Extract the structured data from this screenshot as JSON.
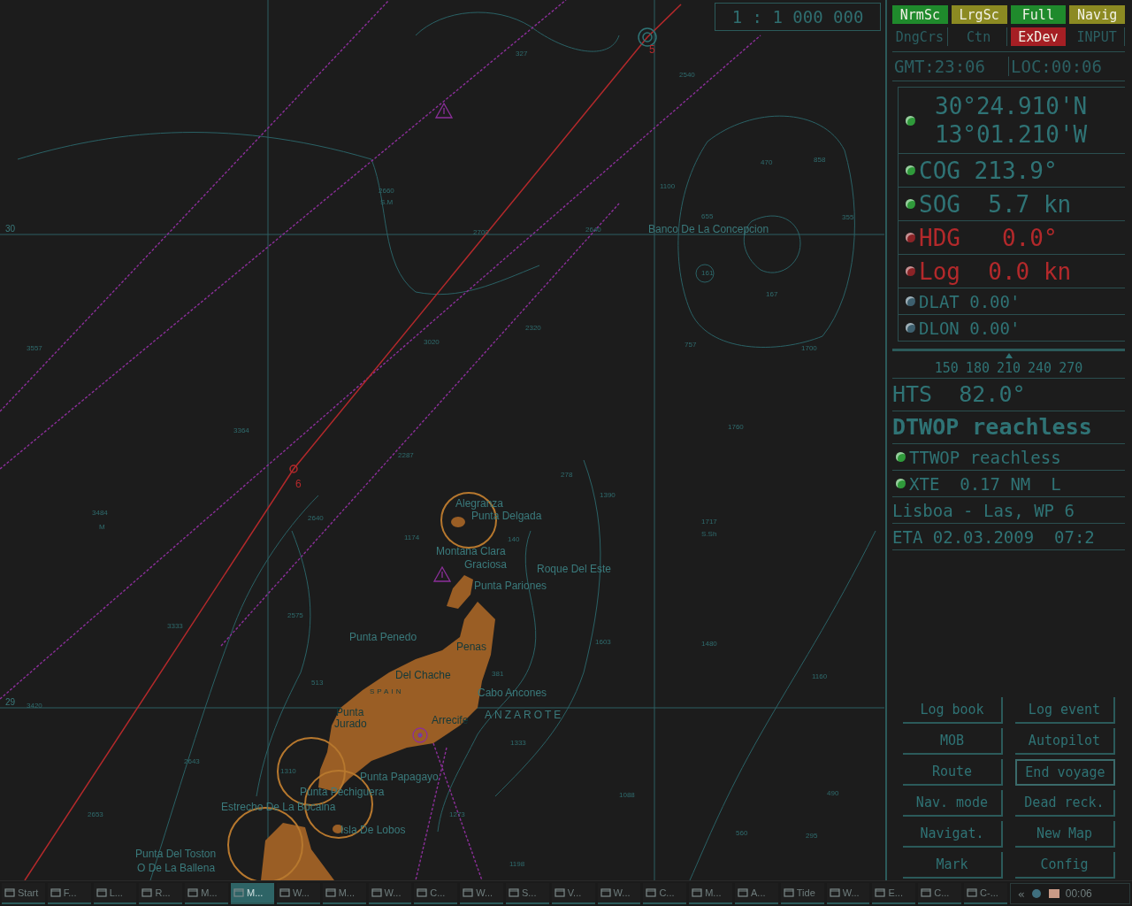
{
  "chart": {
    "scale": "1 : 1 000 000",
    "labels": [
      {
        "kind": "place",
        "text": "Banco De La Concepcion"
      },
      {
        "kind": "place",
        "text": "Alegranza"
      },
      {
        "kind": "place",
        "text": "Punta Delgada"
      },
      {
        "kind": "place",
        "text": "Montana Clara"
      },
      {
        "kind": "place",
        "text": "Graciosa"
      },
      {
        "kind": "place",
        "text": "Roque Del Este"
      },
      {
        "kind": "place",
        "text": "Punta Pariones"
      },
      {
        "kind": "place",
        "text": "Punta Penedo"
      },
      {
        "kind": "land",
        "text": "Penas"
      },
      {
        "kind": "land",
        "text": "Del Chache"
      },
      {
        "kind": "country",
        "text": "SPAIN"
      },
      {
        "kind": "place",
        "text": "Cabo Ancones"
      },
      {
        "kind": "land",
        "text": "Punta"
      },
      {
        "kind": "land",
        "text": "Jurado"
      },
      {
        "kind": "land",
        "text": "Arrecife"
      },
      {
        "kind": "island",
        "text": "ANZAROTE"
      },
      {
        "kind": "place",
        "text": "Punta Papagayo"
      },
      {
        "kind": "place",
        "text": "Punta Pechiguera"
      },
      {
        "kind": "place",
        "text": "Estrecho De La Bocaina"
      },
      {
        "kind": "place",
        "text": "Isla De Lobos"
      },
      {
        "kind": "place",
        "text": "Punta Del Toston"
      },
      {
        "kind": "place",
        "text": "O De La Ballena"
      },
      {
        "kind": "grid",
        "text": "30"
      },
      {
        "kind": "grid",
        "text": "29"
      },
      {
        "kind": "waypoint",
        "text": "5"
      },
      {
        "kind": "waypoint",
        "text": "6"
      },
      {
        "kind": "depth",
        "text": "327"
      },
      {
        "kind": "depth",
        "text": "2540"
      },
      {
        "kind": "depth",
        "text": "470"
      },
      {
        "kind": "depth",
        "text": "858"
      },
      {
        "kind": "depth",
        "text": "1100"
      },
      {
        "kind": "depth",
        "text": "2660"
      },
      {
        "kind": "depth",
        "text": "S.M"
      },
      {
        "kind": "depth",
        "text": "655"
      },
      {
        "kind": "depth",
        "text": "355"
      },
      {
        "kind": "depth",
        "text": "2640"
      },
      {
        "kind": "depth",
        "text": "2700"
      },
      {
        "kind": "depth",
        "text": "161"
      },
      {
        "kind": "depth",
        "text": "167"
      },
      {
        "kind": "depth",
        "text": "2320"
      },
      {
        "kind": "depth",
        "text": "3020"
      },
      {
        "kind": "depth",
        "text": "757"
      },
      {
        "kind": "depth",
        "text": "1700"
      },
      {
        "kind": "depth",
        "text": "3557"
      },
      {
        "kind": "depth",
        "text": "3364"
      },
      {
        "kind": "depth",
        "text": "2287"
      },
      {
        "kind": "depth",
        "text": "1760"
      },
      {
        "kind": "depth",
        "text": "278"
      },
      {
        "kind": "depth",
        "text": "1390"
      },
      {
        "kind": "depth",
        "text": "3484"
      },
      {
        "kind": "depth",
        "text": "2640"
      },
      {
        "kind": "depth",
        "text": "1174"
      },
      {
        "kind": "depth",
        "text": "140"
      },
      {
        "kind": "depth",
        "text": "1717"
      },
      {
        "kind": "depth",
        "text": "S.Sh"
      },
      {
        "kind": "depth",
        "text": "2575"
      },
      {
        "kind": "depth",
        "text": "3333"
      },
      {
        "kind": "depth",
        "text": "1603"
      },
      {
        "kind": "depth",
        "text": "1480"
      },
      {
        "kind": "depth",
        "text": "513"
      },
      {
        "kind": "depth",
        "text": "381"
      },
      {
        "kind": "depth",
        "text": "1160"
      },
      {
        "kind": "depth",
        "text": "3420"
      },
      {
        "kind": "depth",
        "text": "1333"
      },
      {
        "kind": "depth",
        "text": "1310"
      },
      {
        "kind": "depth",
        "text": "2643"
      },
      {
        "kind": "depth",
        "text": "2653"
      },
      {
        "kind": "depth",
        "text": "1273"
      },
      {
        "kind": "depth",
        "text": "1088"
      },
      {
        "kind": "depth",
        "text": "490"
      },
      {
        "kind": "depth",
        "text": "560"
      },
      {
        "kind": "depth",
        "text": "295"
      },
      {
        "kind": "depth",
        "text": "1198"
      },
      {
        "kind": "depth",
        "text": "M"
      }
    ]
  },
  "mode_buttons": [
    {
      "label": "NrmSc",
      "color": "#1f8a2c"
    },
    {
      "label": "LrgSc",
      "color": "#8c8a22"
    },
    {
      "label": "Full",
      "color": "#1f8a2c"
    },
    {
      "label": "Navig",
      "color": "#8c8a22"
    },
    {
      "label": "DngCrs"
    },
    {
      "label": "Ctn"
    },
    {
      "label": "ExDev",
      "color": "#a51f24"
    },
    {
      "label": "INPUT"
    }
  ],
  "clock": {
    "gmt": "GMT:23:06",
    "loc": "LOC:00:06"
  },
  "position": {
    "alarm": false,
    "lat": "30°24.910'N",
    "lon": "13°01.210'W"
  },
  "readouts": [
    {
      "kind": "large",
      "alarm": false,
      "text": "COG 213.9°"
    },
    {
      "kind": "large",
      "alarm": false,
      "text": "SOG  5.7 kn"
    },
    {
      "kind": "large",
      "alarm": true,
      "text": "HDG   0.0°"
    },
    {
      "kind": "large",
      "alarm": true,
      "text": "Log  0.0 kn"
    },
    {
      "kind": "small",
      "alarm": false,
      "text": "DLAT 0.00'"
    },
    {
      "kind": "small",
      "alarm": false,
      "text": "DLON 0.00'"
    }
  ],
  "compass": {
    "ticks": [
      "150",
      "180",
      "210",
      "240",
      "270"
    ],
    "level": 0.5
  },
  "hts": "HTS  82.0°",
  "dtwop": "DTWOP reachless",
  "route_readouts": [
    {
      "alarm": false,
      "text": "TTWOP reachless"
    },
    {
      "alarm": false,
      "text": "XTE  0.17 NM  L"
    }
  ],
  "route": "Lisboa - Las, WP 6",
  "eta": "ETA 02.03.2009  07:2",
  "buttons": [
    {
      "label": "Log book",
      "selected": false
    },
    {
      "label": "Log event",
      "selected": false
    },
    {
      "label": "MOB",
      "selected": false
    },
    {
      "label": "Autopilot",
      "selected": false
    },
    {
      "label": "Route",
      "selected": false
    },
    {
      "label": "End voyage",
      "selected": true
    },
    {
      "label": "Nav. mode",
      "selected": false
    },
    {
      "label": "Dead reck.",
      "selected": false
    },
    {
      "label": "Navigat.",
      "selected": false
    },
    {
      "label": "New Map",
      "selected": false
    },
    {
      "label": "Mark",
      "selected": false
    },
    {
      "label": "Config",
      "selected": false
    }
  ],
  "taskbar": {
    "items": [
      {
        "label": "Start",
        "selected": false
      },
      {
        "label": "F...",
        "selected": false
      },
      {
        "label": "L...",
        "selected": false
      },
      {
        "label": "R...",
        "selected": false
      },
      {
        "label": "M...",
        "selected": false
      },
      {
        "label": "M...",
        "selected": true
      },
      {
        "label": "W...",
        "selected": false
      },
      {
        "label": "M...",
        "selected": false
      },
      {
        "label": "W...",
        "selected": false
      },
      {
        "label": "C...",
        "selected": false
      },
      {
        "label": "W...",
        "selected": false
      },
      {
        "label": "S...",
        "selected": false
      },
      {
        "label": "V...",
        "selected": false
      },
      {
        "label": "W...",
        "selected": false
      },
      {
        "label": "C...",
        "selected": false
      },
      {
        "label": "M...",
        "selected": false
      },
      {
        "label": "A...",
        "selected": false
      },
      {
        "label": "Tide",
        "selected": false
      },
      {
        "label": "W...",
        "selected": false
      },
      {
        "label": "E...",
        "selected": false
      },
      {
        "label": "C...",
        "selected": false
      },
      {
        "label": "C-...",
        "selected": false
      }
    ],
    "tray_arrow": "«",
    "time": "00:06"
  }
}
